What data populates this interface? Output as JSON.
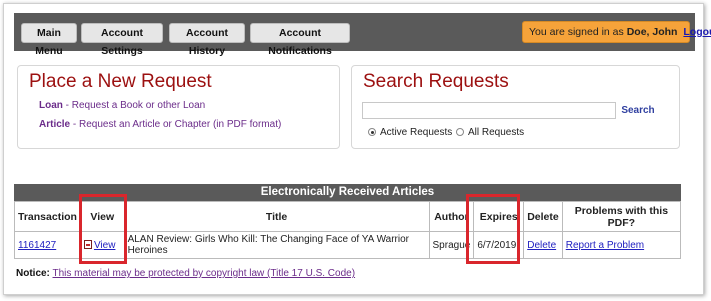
{
  "nav": {
    "main_menu": "Main Menu",
    "account_settings": "Account Settings",
    "account_history": "Account History",
    "account_notifications": "Account Notifications"
  },
  "signin": {
    "prefix": "You are signed in as",
    "name": "Doe, John",
    "logout": "Logout"
  },
  "new_request": {
    "title": "Place a New Request",
    "loan_label": "Loan",
    "loan_desc": " - Request a Book or other Loan",
    "article_label": "Article",
    "article_desc": " - Request an Article or Chapter (in PDF format)"
  },
  "search": {
    "title": "Search Requests",
    "input_value": "",
    "button": "Search",
    "radio_active": "Active Requests",
    "radio_all": "All Requests"
  },
  "table": {
    "title": "Electronically Received Articles",
    "headers": [
      "Transaction",
      "View",
      "Title",
      "Author",
      "Expires",
      "Delete",
      "Problems with this PDF?"
    ],
    "rows": [
      {
        "transaction": "1161427",
        "view": "View",
        "title": "ALAN Review: Girls Who Kill: The Changing Face of YA Warrior Heroines",
        "author": "Sprague",
        "expires": "6/7/2019",
        "delete": "Delete",
        "problem": "Report a Problem"
      }
    ]
  },
  "notice": {
    "label": "Notice:",
    "text": "This material may be protected by copyright law (Title 17 U.S. Code)"
  },
  "colors": {
    "navbar": "#5a5a5a",
    "signin_bg": "#f6a33a",
    "title_red": "#9c1010",
    "highlight_box": "#d9262c",
    "link": "#2020c0"
  }
}
